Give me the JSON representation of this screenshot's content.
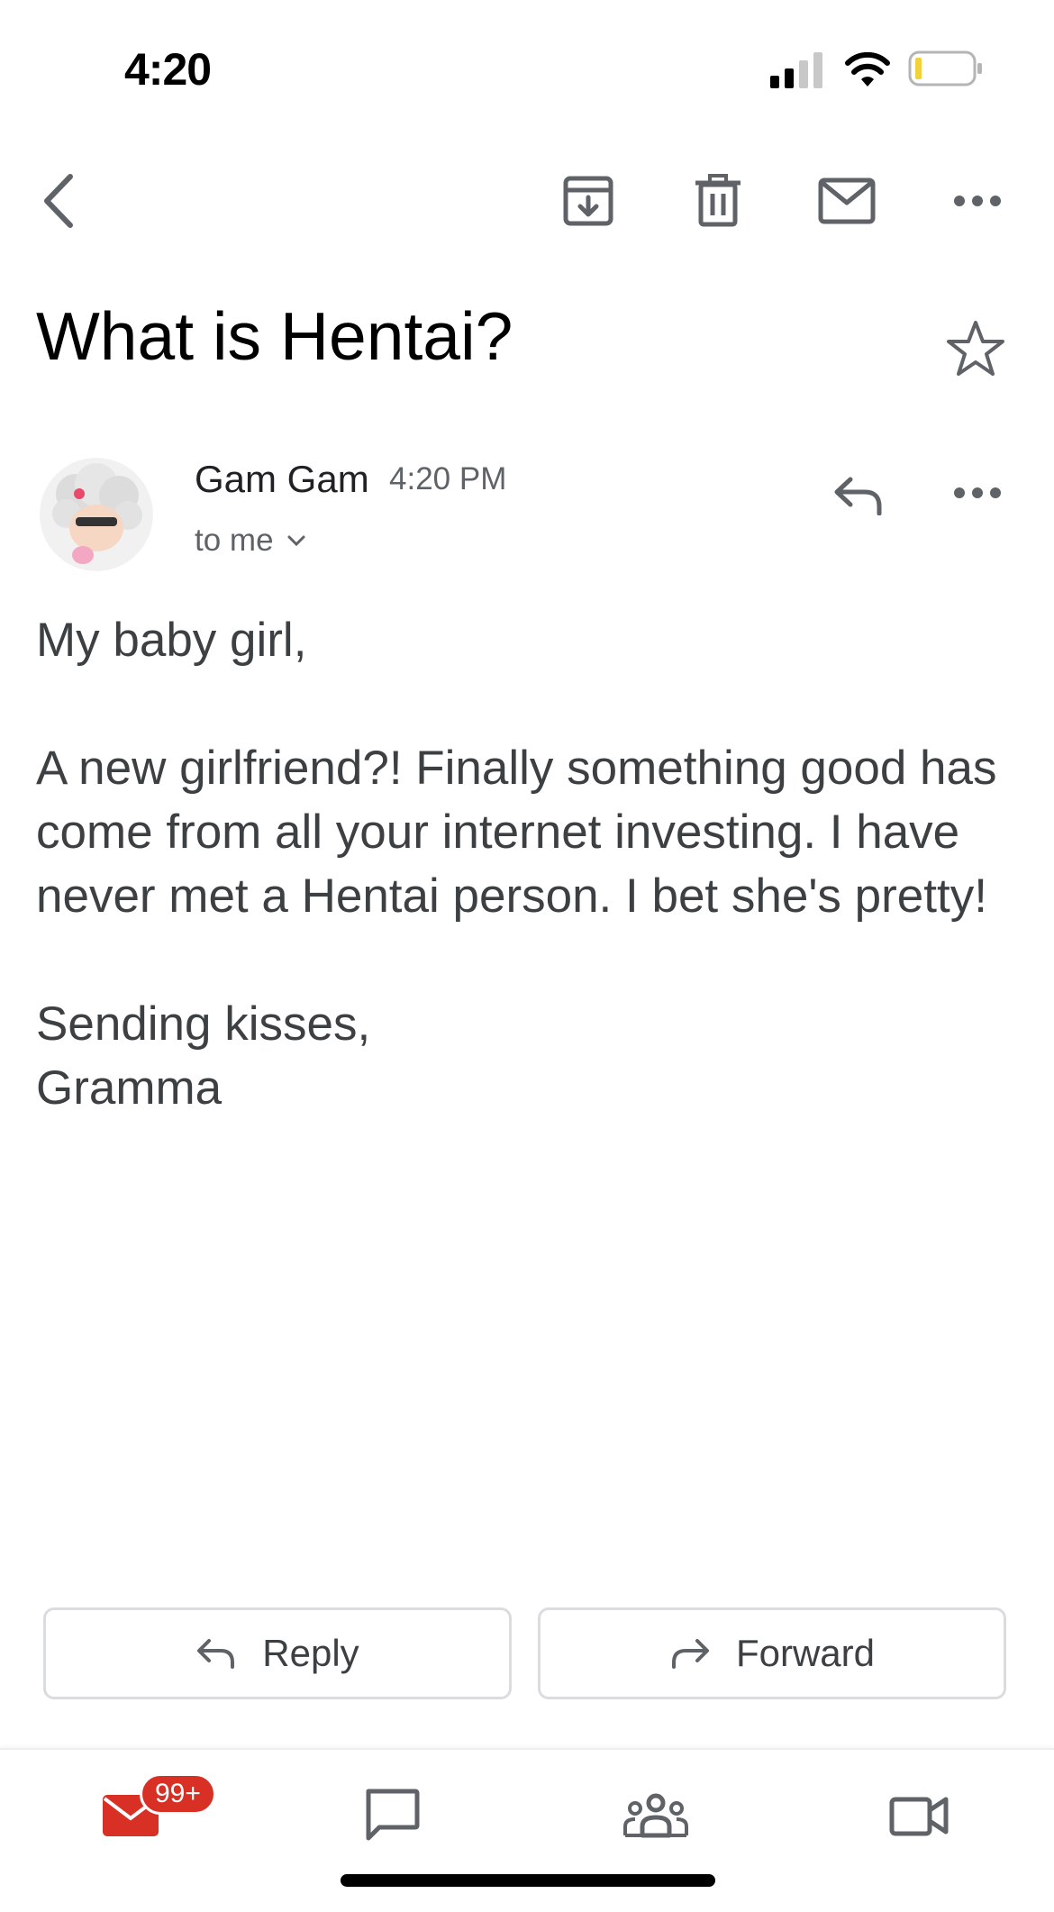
{
  "status_bar": {
    "time": "4:20"
  },
  "toolbar": {
    "back": "chevron-left-icon",
    "archive": "archive-icon",
    "delete": "trash-icon",
    "mark_unread": "mail-icon",
    "more": "more-horizontal-icon"
  },
  "email": {
    "subject": "What is Hentai?",
    "sender_name": "Gam Gam",
    "time": "4:20 PM",
    "recipient": "to me",
    "body": "My baby girl,\n\nA new girlfriend?! Finally something good has come from all your internet investing. I have never met a Hentai person. I bet she's pretty!\n\nSending kisses,\nGramma"
  },
  "actions": {
    "reply": "Reply",
    "forward": "Forward"
  },
  "bottom_nav": {
    "mail_badge": "99+",
    "items": [
      "mail-icon",
      "chat-icon",
      "spaces-icon",
      "meet-icon"
    ]
  },
  "colors": {
    "accent_red": "#d93025",
    "icon_gray": "#5f6368",
    "border": "#dadce0"
  }
}
